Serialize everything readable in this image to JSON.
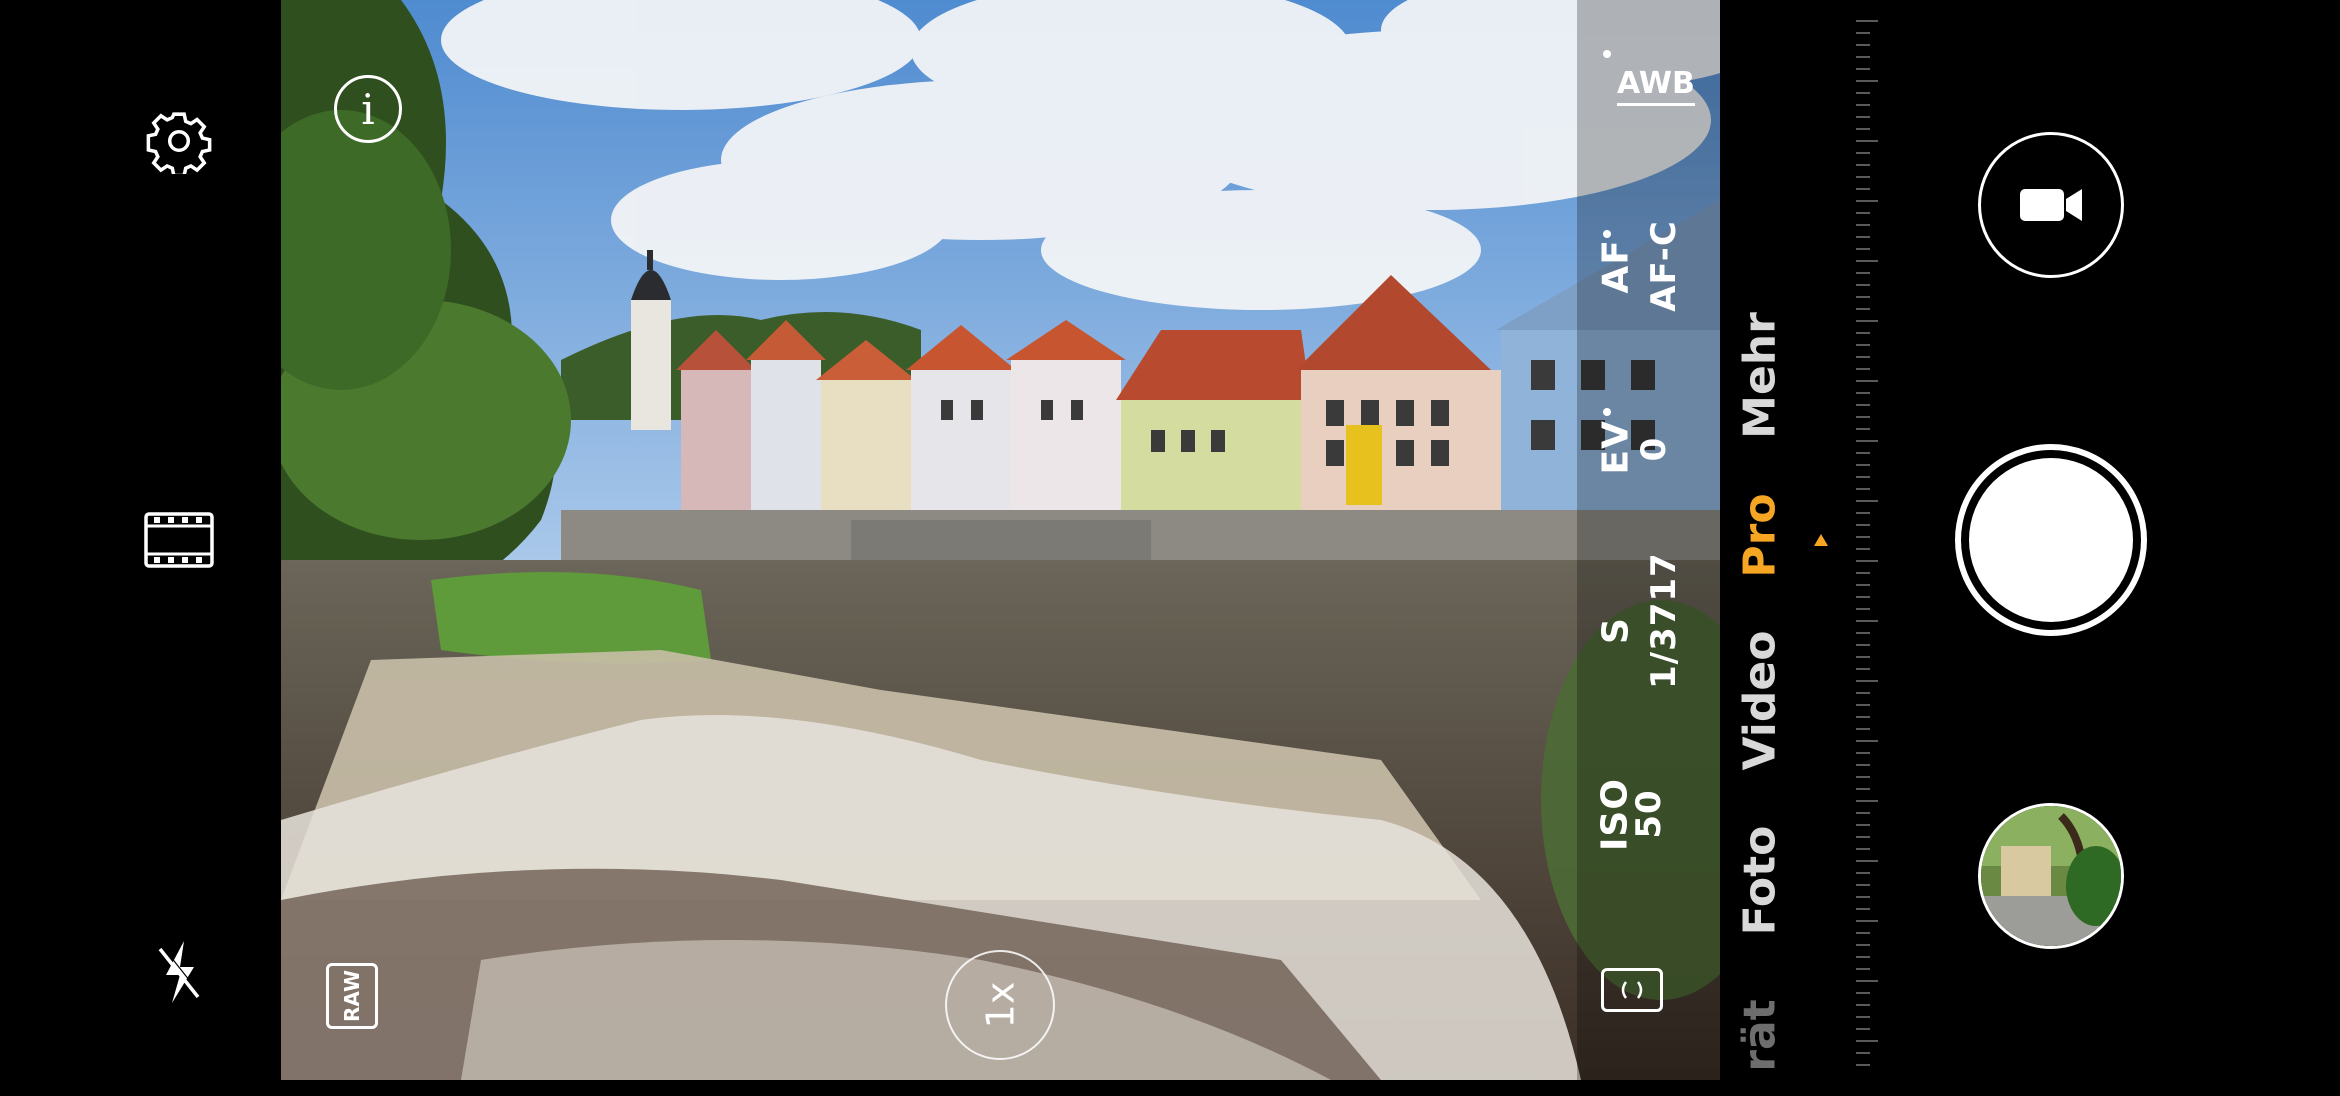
{
  "left_bar": {
    "settings": "gear-icon",
    "filmstrip": "film-icon",
    "flash": "flash-off-icon"
  },
  "overlay": {
    "info": "i",
    "raw_label": "RAW",
    "zoom": "1x"
  },
  "pro_params": {
    "awb": "AWB",
    "af_label": "AF",
    "af_value": "AF-C",
    "ev_label": "EV",
    "ev_value": "0",
    "s_label": "S",
    "s_value": "1/3717",
    "iso_label": "ISO",
    "iso_value": "50"
  },
  "modes": {
    "partial": "rät",
    "foto": "Foto",
    "video": "Video",
    "pro": "Pro",
    "mehr": "Mehr"
  },
  "colors": {
    "accent": "#f6a623"
  }
}
